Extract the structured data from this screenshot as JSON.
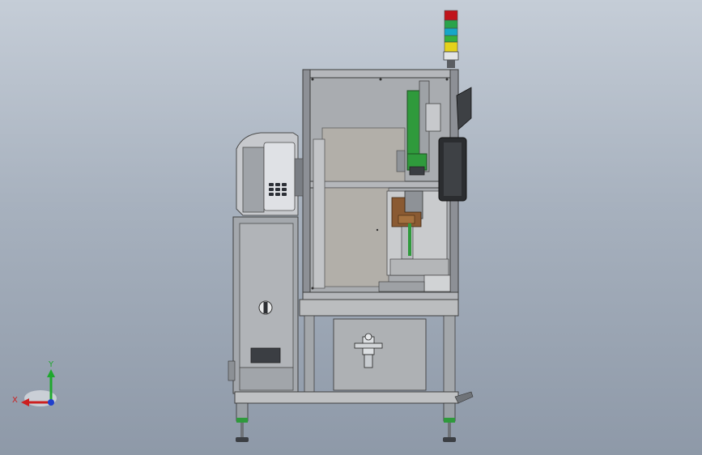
{
  "app": {
    "title": ""
  },
  "colors": {
    "background_top": "#c5cdd7",
    "background_bottom": "#8e99a8",
    "frame": "#8d9096",
    "panel": "#b7b4ae",
    "glass": "#a9adb3",
    "cabinet": "#9ea3a9",
    "cylinder_green": "#2f9a3c",
    "fixture_brown": "#8a5a32",
    "axis_x": "#cc1f1f",
    "axis_y": "#1fa82e",
    "axis_z": "#1f3fcc"
  },
  "signal_tower": {
    "lights": [
      "red",
      "green",
      "blue",
      "green",
      "yellow"
    ]
  },
  "triad": {
    "x_label": "X",
    "y_label": "Y"
  }
}
